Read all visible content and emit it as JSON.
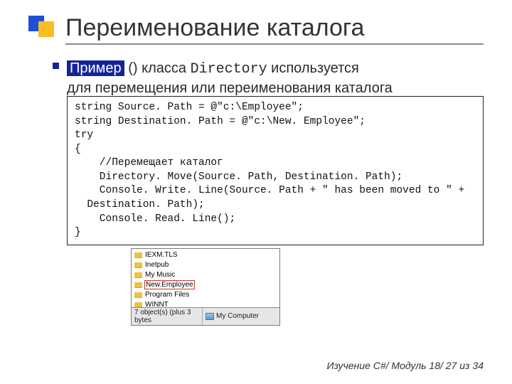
{
  "title": "Переименование каталога",
  "bullet": {
    "highlight": "Пример",
    "after_highlight": " () класса ",
    "class_name": "Directory",
    "tail": " используется",
    "line2": "для перемещения или переименования каталога"
  },
  "code": "string Source. Path = @\"c:\\Employee\";\nstring Destination. Path = @\"c:\\New. Employee\";\ntry\n{\n    //Перемещает каталог\n    Directory. Move(Source. Path, Destination. Path);\n    Console. Write. Line(Source. Path + \" has been moved to \" +\n  Destination. Path);\n    Console. Read. Line();\n}",
  "explorer": {
    "items": [
      {
        "name": "IEXM.TLS",
        "boxed": false
      },
      {
        "name": "Inetpub",
        "boxed": false
      },
      {
        "name": "My Music",
        "boxed": false
      },
      {
        "name": "New.Employee",
        "boxed": true
      },
      {
        "name": "Program Files",
        "boxed": false
      },
      {
        "name": "WINNT",
        "boxed": false
      }
    ],
    "status_left": "7 object(s) (plus 3 bytes",
    "status_right": "My Computer"
  },
  "footer": "Изучение C#/ Модуль 18/ 27 из 34"
}
